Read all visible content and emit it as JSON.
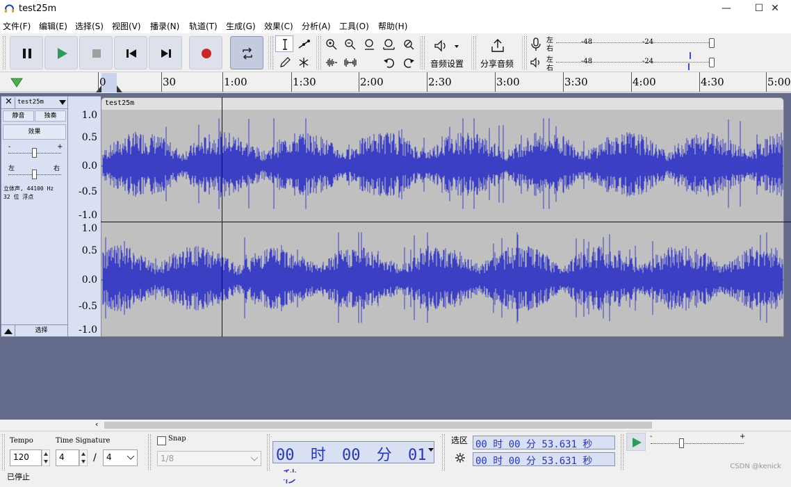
{
  "window": {
    "title": "test25m",
    "minimize": "—",
    "maximize": "☐",
    "close": "✕"
  },
  "menu": [
    "文件(F)",
    "编辑(E)",
    "选择(S)",
    "视图(V)",
    "播录(N)",
    "轨道(T)",
    "生成(G)",
    "效果(C)",
    "分析(A)",
    "工具(O)",
    "帮助(H)"
  ],
  "toolbar": {
    "audio_setup_label": "音频设置",
    "share_audio_label": "分享音频",
    "meter_left": "左",
    "meter_right": "右",
    "meter_ticks": [
      "-48",
      "-24"
    ]
  },
  "ruler": {
    "labels": [
      "0",
      "30",
      "1:00",
      "1:30",
      "2:00",
      "2:30",
      "3:00",
      "3:30",
      "4:00",
      "4:30",
      "5:00"
    ]
  },
  "track": {
    "name": "test25m",
    "mute": "静音",
    "solo": "独奏",
    "effects": "效果",
    "gain_minus": "-",
    "gain_plus": "+",
    "pan_left": "左",
    "pan_right": "右",
    "info_line1": "立体声, 44100 Hz",
    "info_line2": "32 位 浮点",
    "select": "选择",
    "vscale": [
      "1.0",
      "0.5",
      "0.0",
      "-0.5",
      "-1.0"
    ]
  },
  "clip": {
    "name": "test25m"
  },
  "bottom": {
    "tempo_label": "Tempo",
    "tempo_value": "120",
    "time_sig_label": "Time Signature",
    "time_sig_num": "4",
    "time_sig_slash": "/",
    "time_sig_den": "4",
    "snap_label": "Snap",
    "snap_value": "1/8",
    "time_display": [
      "00",
      "时",
      "00",
      "分",
      "01",
      "秒"
    ],
    "selection_label": "选区",
    "sel_start": "00 时 00 分 53.631 秒",
    "sel_end": "00 时 00 分 53.631 秒"
  },
  "status": {
    "text": "已停止"
  },
  "watermark": "CSDN @kenick"
}
